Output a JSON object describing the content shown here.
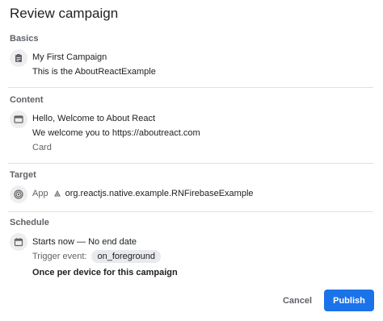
{
  "dialog": {
    "title": "Review campaign"
  },
  "basics": {
    "label": "Basics",
    "campaign_name": "My First Campaign",
    "description": "This is the AboutReactExample"
  },
  "content": {
    "label": "Content",
    "message_title": "Hello, Welcome to About React",
    "message_body": "We welcome you to https://aboutreact.com",
    "layout": "Card"
  },
  "target": {
    "label": "Target",
    "app_label": "App",
    "app_id": "org.reactjs.native.example.RNFirebaseExample"
  },
  "schedule": {
    "label": "Schedule",
    "starts": "Starts now — No end date",
    "trigger_label": "Trigger event:",
    "trigger_event": "on_foreground",
    "frequency": "Once per device for this campaign"
  },
  "actions": {
    "cancel": "Cancel",
    "publish": "Publish"
  },
  "colors": {
    "primary": "#1a73e8",
    "muted": "#5f6368",
    "divider": "#e0e0e0"
  },
  "icons": {
    "basics": "clipboard-icon",
    "content": "card-message-icon",
    "target": "target-icon",
    "app": "app-icon",
    "schedule": "calendar-icon"
  }
}
